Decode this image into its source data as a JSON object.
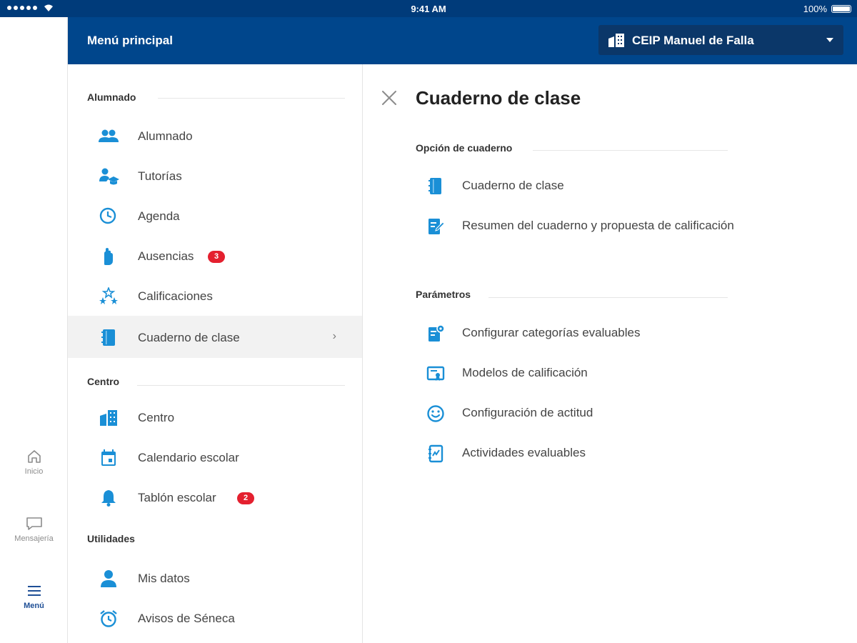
{
  "status_bar": {
    "time": "9:41 AM",
    "battery": "100%"
  },
  "rail": {
    "items": [
      {
        "label": "Inicio",
        "icon": "home-icon",
        "active": false
      },
      {
        "label": "Mensajería",
        "icon": "chat-icon",
        "active": false
      },
      {
        "label": "Menú",
        "icon": "hamburger-icon",
        "active": true
      }
    ]
  },
  "header": {
    "title": "Menú principal",
    "school_select": {
      "value": "CEIP Manuel de Falla",
      "icon": "building-icon"
    }
  },
  "menu": {
    "sections": [
      {
        "title": "Alumnado",
        "items": [
          {
            "label": "Alumnado",
            "icon": "people-icon"
          },
          {
            "label": "Tutorías",
            "icon": "tutor-icon"
          },
          {
            "label": "Agenda",
            "icon": "clock-icon"
          },
          {
            "label": "Ausencias",
            "icon": "hand-icon",
            "badge": "3"
          },
          {
            "label": "Calificaciones",
            "icon": "stars-icon"
          },
          {
            "label": "Cuaderno de clase",
            "icon": "notebook-icon",
            "selected": true
          }
        ]
      },
      {
        "title": "Centro",
        "items": [
          {
            "label": "Centro",
            "icon": "building-icon"
          },
          {
            "label": "Calendario escolar",
            "icon": "calendar-icon"
          },
          {
            "label": "Tablón escolar",
            "icon": "bell-icon",
            "badge": "2"
          }
        ]
      },
      {
        "title": "Utilidades",
        "items": [
          {
            "label": "Mis datos",
            "icon": "person-icon"
          },
          {
            "label": "Avisos de Séneca",
            "icon": "alarm-icon"
          }
        ]
      }
    ],
    "chevron": "›"
  },
  "detail": {
    "title": "Cuaderno de clase",
    "sections": [
      {
        "title": "Opción de cuaderno",
        "items": [
          {
            "label": "Cuaderno de clase",
            "icon": "notebook-icon"
          },
          {
            "label": "Resumen del cuaderno y propuesta de calificación",
            "icon": "note-edit-icon"
          }
        ]
      },
      {
        "title": "Parámetros",
        "items": [
          {
            "label": "Configurar categorías evaluables",
            "icon": "category-settings-icon"
          },
          {
            "label": "Modelos de calificación",
            "icon": "certificate-icon"
          },
          {
            "label": "Configuración de actitud",
            "icon": "smiley-icon"
          },
          {
            "label": "Actividades evaluables",
            "icon": "activity-icon"
          }
        ]
      }
    ]
  },
  "colors": {
    "header_blue": "#00468c",
    "status_blue": "#003b7a",
    "select_bg": "#0b3769",
    "icon_blue": "#1a8fd6",
    "badge_red": "#e4202f",
    "selected_bg": "#f2f2f2"
  }
}
